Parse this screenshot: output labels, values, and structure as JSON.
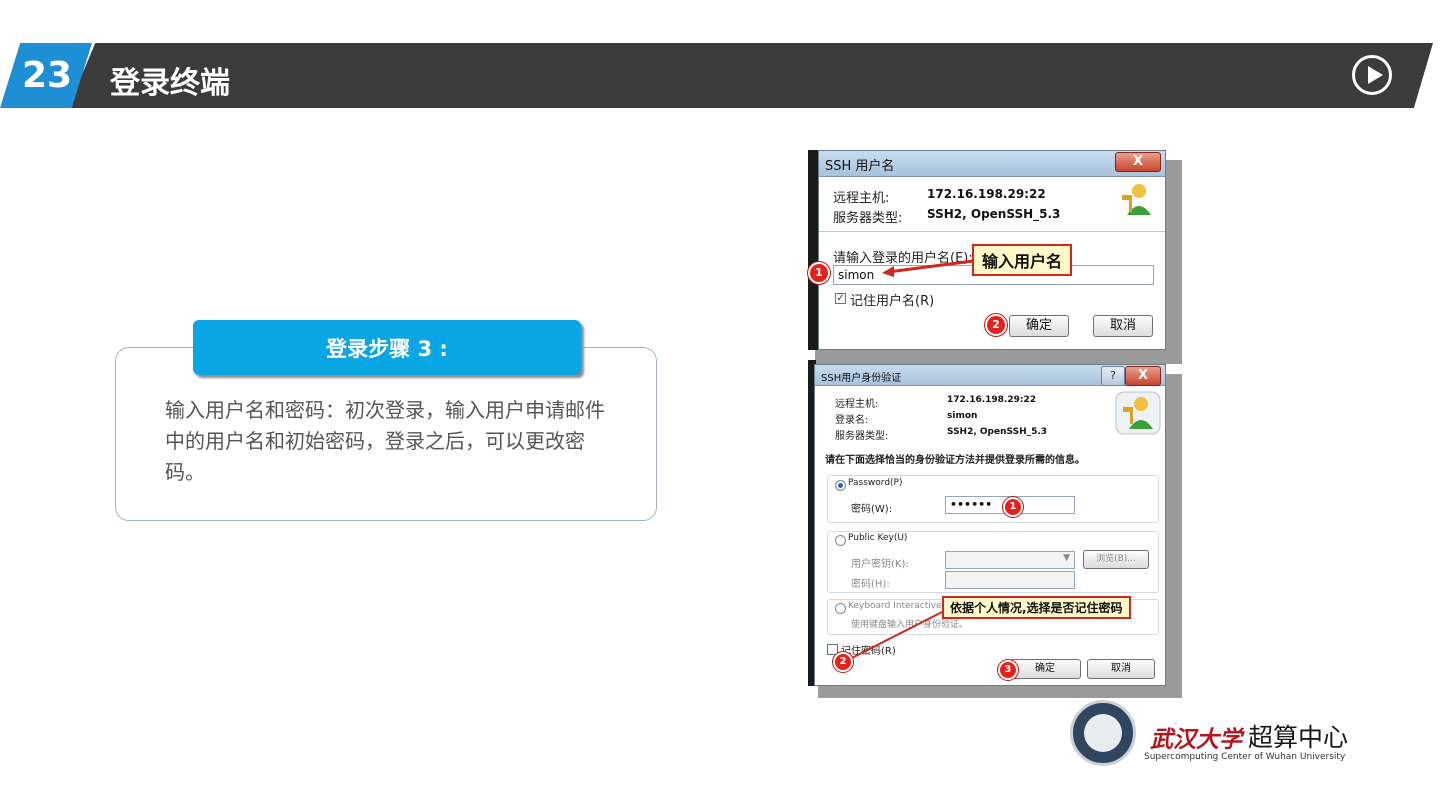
{
  "header": {
    "number": "23",
    "title": "登录终端",
    "play_icon": "play-circle-icon"
  },
  "step": {
    "title": "登录步骤 3 :",
    "description": "输入用户名和密码：初次登录，输入用户申请邮件中的用户名和初始密码，登录之后，可以更改密码。"
  },
  "dialog1": {
    "title": "SSH 用户名",
    "close_label": "X",
    "remote_host_label": "远程主机:",
    "remote_host_value": "172.16.198.29:22",
    "server_type_label": "服务器类型:",
    "server_type_value": "SSH2, OpenSSH_5.3",
    "username_prompt": "请输入登录的用户名(E):",
    "username_value": "simon",
    "remember_username_label": "记住用户名(R)",
    "ok_label": "确定",
    "cancel_label": "取消",
    "callout": "输入用户名",
    "badges": [
      "1",
      "2"
    ]
  },
  "dialog2": {
    "title": "SSH用户身份验证",
    "help_label": "?",
    "close_label": "X",
    "remote_host_label": "远程主机:",
    "remote_host_value": "172.16.198.29:22",
    "login_name_label": "登录名:",
    "login_name_value": "simon",
    "server_type_label": "服务器类型:",
    "server_type_value": "SSH2, OpenSSH_5.3",
    "instruction": "请在下面选择恰当的身份验证方法并提供登录所需的信息。",
    "password_option": "Password(P)",
    "password_label": "密码(W):",
    "password_value": "••••••",
    "public_key_option": "Public Key(U)",
    "user_key_label": "用户密钥(K):",
    "browse_label": "浏览(B)...",
    "passphrase_label": "密码(H):",
    "keyboard_option": "Keyboard Interactive(I)",
    "keyboard_desc": "使用键盘输入用户身份验证。",
    "remember_password_label": "记住密码(R)",
    "ok_label": "确定",
    "cancel_label": "取消",
    "callout": "依据个人情况,选择是否记住密码",
    "badges": [
      "1",
      "2",
      "3"
    ]
  },
  "logo": {
    "school_name": "武汉大学",
    "center_name": "超算中心",
    "subtitle": "Supercomputing Center of Wuhan University"
  }
}
